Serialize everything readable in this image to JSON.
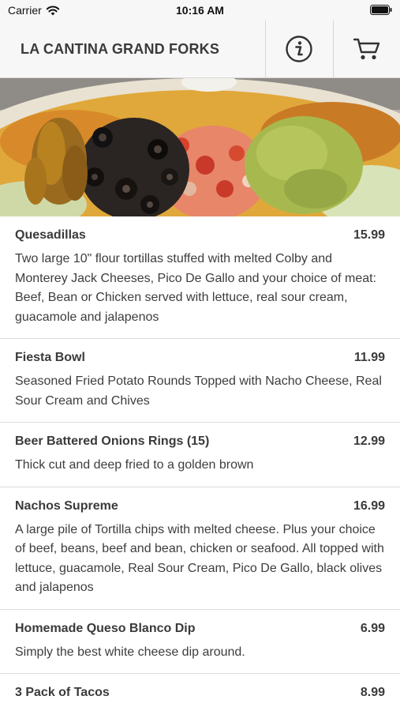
{
  "status_bar": {
    "carrier": "Carrier",
    "time": "10:16 AM"
  },
  "header": {
    "title": "LA CANTINA GRAND FORKS",
    "info_icon": "info-circle-icon",
    "cart_icon": "shopping-cart-icon"
  },
  "hero": {
    "image": "nachos-supreme-photo"
  },
  "menu": {
    "items": [
      {
        "name": "Quesadillas",
        "price": "15.99",
        "description": "Two large 10\" flour tortillas stuffed with melted Colby and Monterey Jack Cheeses, Pico De Gallo and your choice of meat: Beef, Bean or Chicken served with lettuce, real sour cream, guacamole and jalapenos"
      },
      {
        "name": "Fiesta Bowl",
        "price": "11.99",
        "description": "Seasoned Fried Potato Rounds Topped with Nacho Cheese, Real Sour Cream and Chives"
      },
      {
        "name": "Beer Battered Onions Rings (15)",
        "price": "12.99",
        "description": "Thick cut and deep fried to a golden brown"
      },
      {
        "name": "Nachos Supreme",
        "price": "16.99",
        "description": "A large pile of Tortilla chips with melted cheese. Plus your choice of beef, beans, beef and bean, chicken or seafood. All topped with lettuce, guacamole, Real Sour Cream, Pico De Gallo, black olives and jalapenos"
      },
      {
        "name": "Homemade Queso Blanco Dip",
        "price": "6.99",
        "description": "Simply the best white cheese dip around."
      },
      {
        "name": "3 Pack of Tacos",
        "price": "8.99",
        "description": ""
      }
    ]
  }
}
